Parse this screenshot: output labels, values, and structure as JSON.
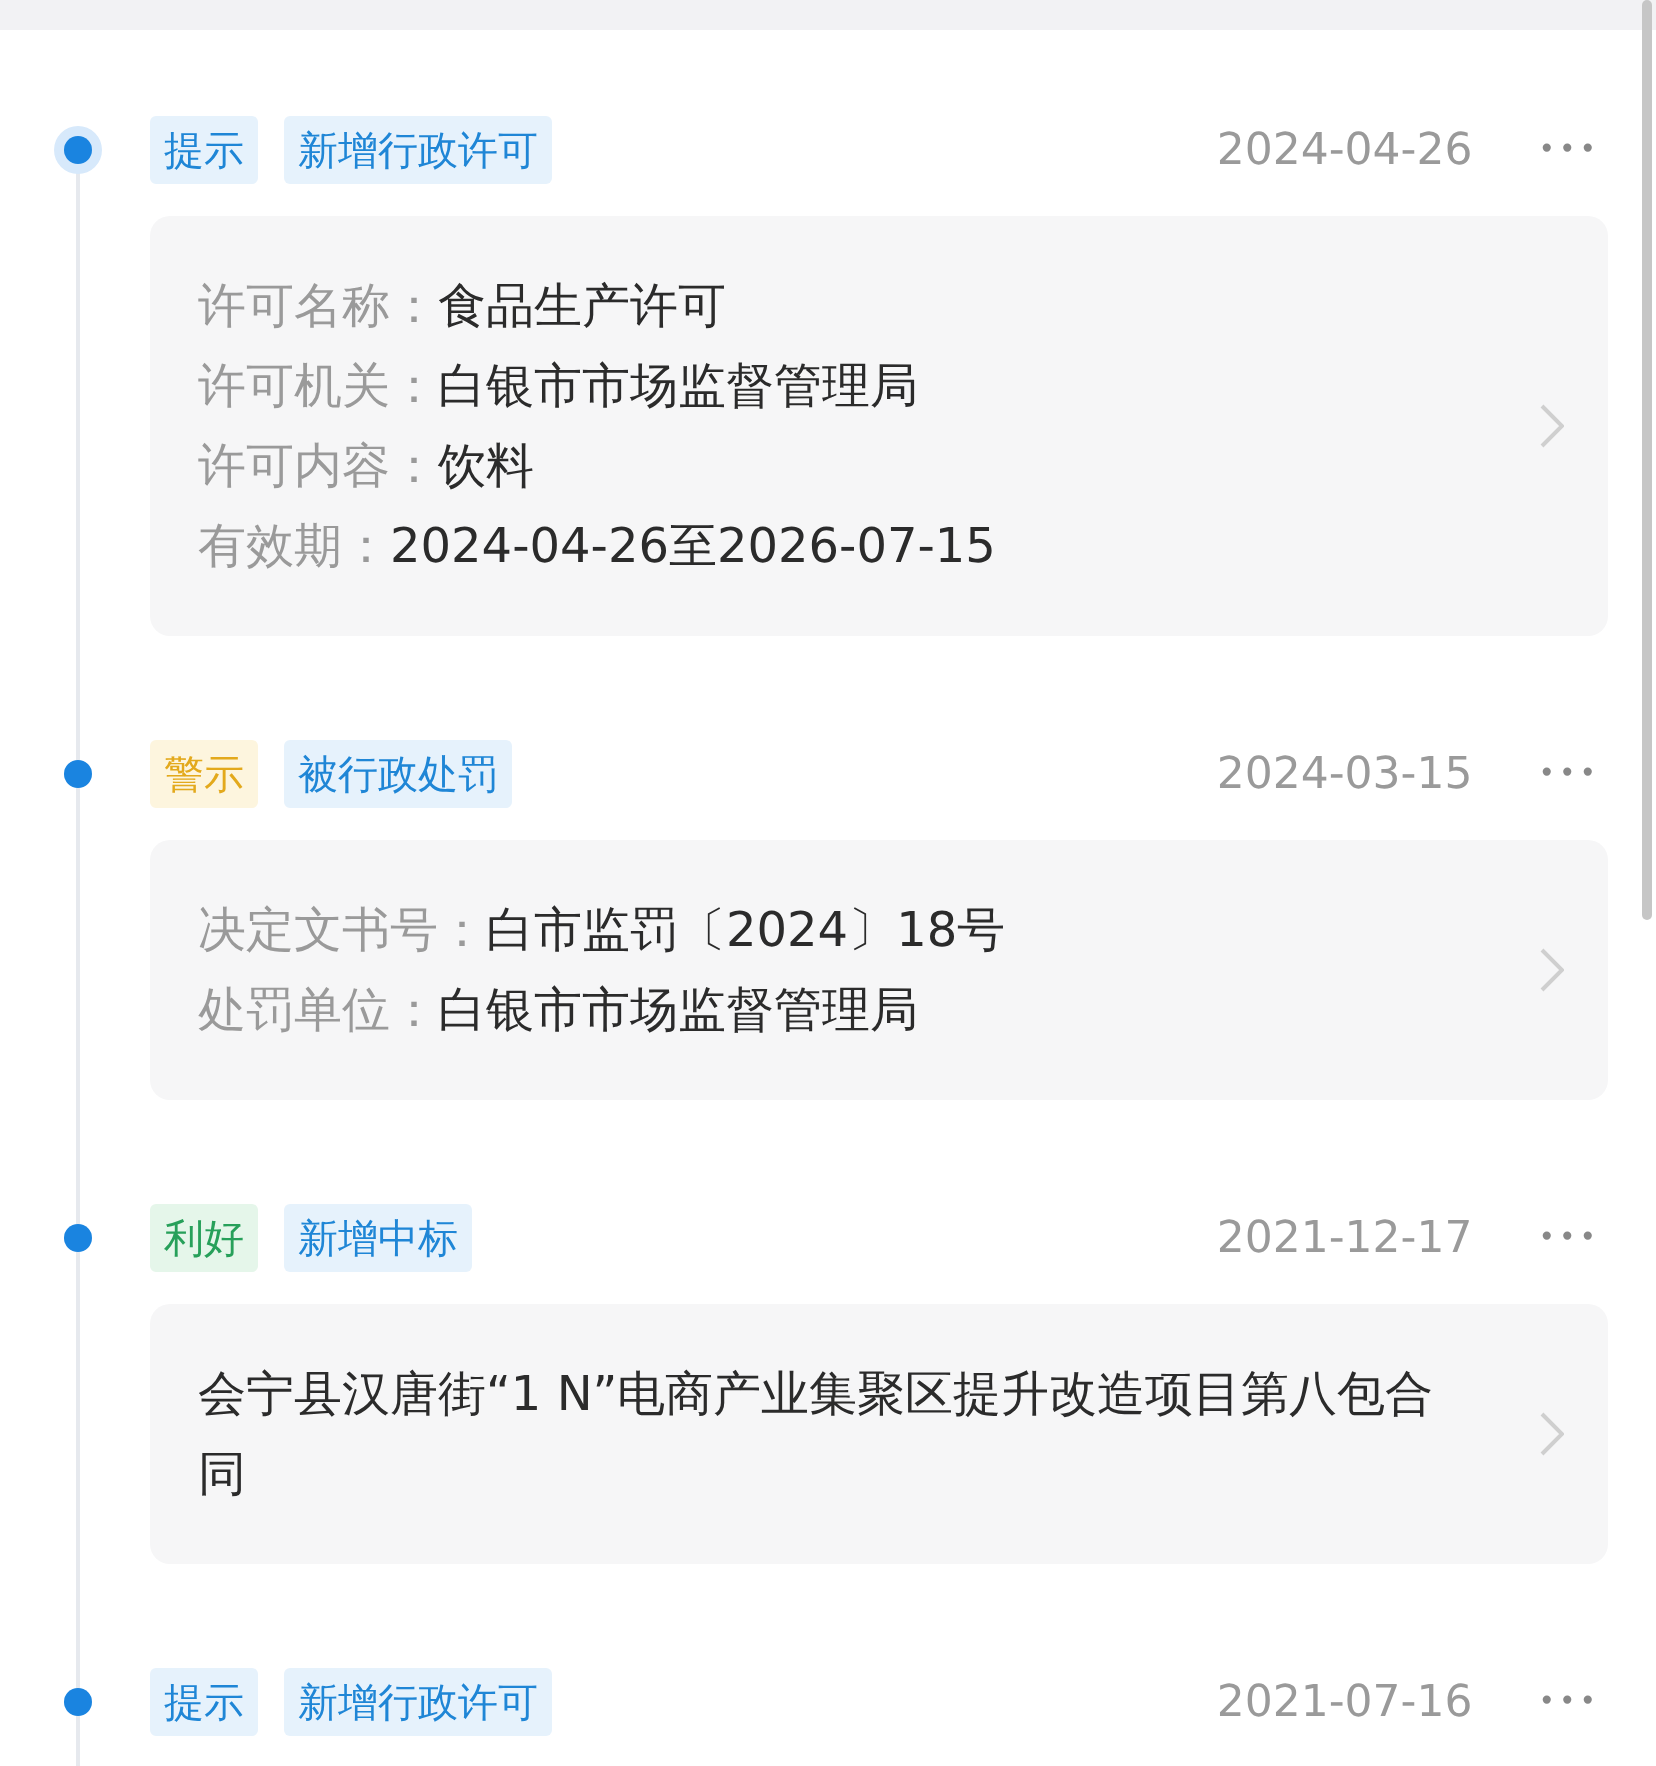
{
  "entries": [
    {
      "current": true,
      "tags": [
        {
          "kind": "tip",
          "text": "提示"
        },
        {
          "kind": "category",
          "text": "新增行政许可"
        }
      ],
      "date": "2024-04-26",
      "more": "•••",
      "details": {
        "kind": "fields",
        "fields": [
          {
            "label": "许可名称：",
            "value": "食品生产许可"
          },
          {
            "label": "许可机关：",
            "value": "白银市市场监督管理局"
          },
          {
            "label": "许可内容：",
            "value": "饮料"
          },
          {
            "label": "有效期：",
            "value": "2024-04-26至2026-07-15"
          }
        ]
      }
    },
    {
      "current": false,
      "tags": [
        {
          "kind": "warning",
          "text": "警示"
        },
        {
          "kind": "category",
          "text": "被行政处罚"
        }
      ],
      "date": "2024-03-15",
      "more": "•••",
      "details": {
        "kind": "fields",
        "fields": [
          {
            "label": "决定文书号：",
            "value": "白市监罚〔2024〕18号"
          },
          {
            "label": "处罚单位：",
            "value": "白银市市场监督管理局"
          }
        ]
      }
    },
    {
      "current": false,
      "tags": [
        {
          "kind": "good",
          "text": "利好"
        },
        {
          "kind": "category",
          "text": "新增中标"
        }
      ],
      "date": "2021-12-17",
      "more": "•••",
      "details": {
        "kind": "text",
        "text": "会宁县汉唐街“1 N”电商产业集聚区提升改造项目第八包合同"
      }
    },
    {
      "current": false,
      "tags": [
        {
          "kind": "tip",
          "text": "提示"
        },
        {
          "kind": "category",
          "text": "新增行政许可"
        }
      ],
      "date": "2021-07-16",
      "more": "•••",
      "details": {
        "kind": "empty"
      }
    }
  ]
}
